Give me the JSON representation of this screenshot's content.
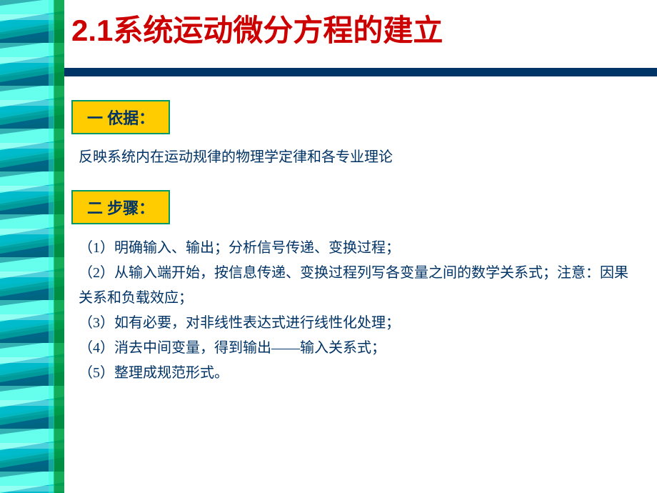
{
  "slide": {
    "title": "2.1系统运动微分方程的建立",
    "topbar_color": "#003366",
    "section1": {
      "label": "一  依据：",
      "content": "反映系统内在运动规律的物理学定律和各专业理论"
    },
    "section2": {
      "label": "二  步骤：",
      "steps": [
        "（1）明确输入、输出；分析信号传递、变换过程；",
        "（2）从输入端开始，按信息传递、变换过程列写各变量之间的数学关系式；注意：因果关系和负载效应；",
        "（3）如有必要，对非线性表达式进行线性化处理；",
        "（4）消去中间变量，得到输出——输入关系式；",
        "（5）整理成规范形式。"
      ]
    }
  }
}
